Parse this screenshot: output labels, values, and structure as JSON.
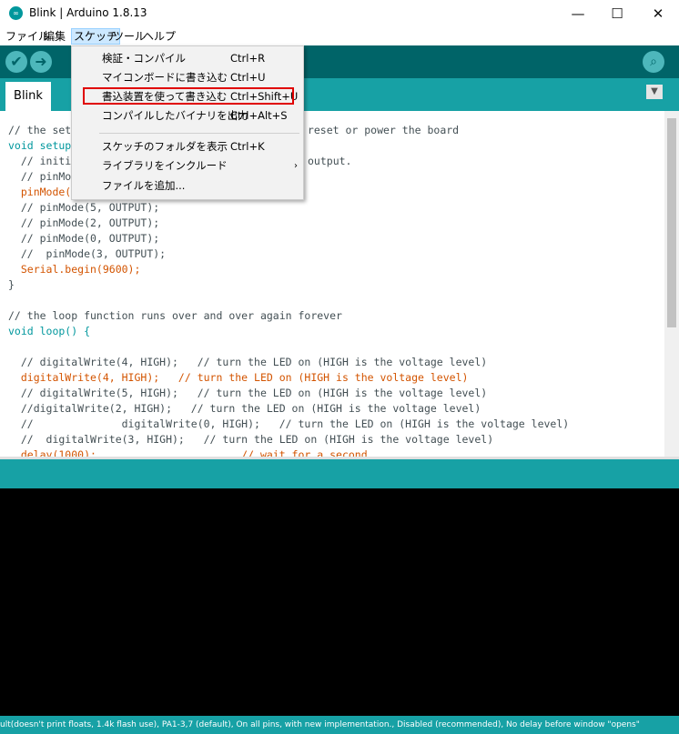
{
  "window": {
    "title": "Blink | Arduino 1.8.13",
    "minimize": "—",
    "maximize": "☐",
    "close": "✕"
  },
  "menubar": {
    "items": [
      "ファイル",
      "編集",
      "スケッチ",
      "ツール",
      "ヘルプ"
    ],
    "active_index": 2
  },
  "toolbar": {
    "verify_icon": "check-icon",
    "upload_icon": "arrow-right-icon",
    "serial_icon": "magnifier-icon"
  },
  "tabs": {
    "active": "Blink",
    "menu_icon": "▼"
  },
  "sketch_menu": {
    "items": [
      {
        "label": "検証・コンパイル",
        "shortcut": "Ctrl+R"
      },
      {
        "label": "マイコンボードに書き込む",
        "shortcut": "Ctrl+U"
      },
      {
        "label": "書込装置を使って書き込む",
        "shortcut": "Ctrl+Shift+U"
      },
      {
        "label": "コンパイルしたバイナリを出力",
        "shortcut": "Ctrl+Alt+S"
      },
      {
        "label": "スケッチのフォルダを表示",
        "shortcut": "Ctrl+K"
      },
      {
        "label": "ライブラリをインクルード",
        "shortcut": "",
        "submenu_arrow": "›"
      },
      {
        "label": "ファイルを追加...",
        "shortcut": ""
      }
    ]
  },
  "code": {
    "lines": [
      "// the set",
      " reset or power the board",
      "void setup",
      "  // initi",
      "output.",
      "  // pinMo",
      "  pinMode(",
      "  // pinMode(5, OUTPUT);",
      "  // pinMode(2, OUTPUT);",
      "  // pinMode(0, OUTPUT);",
      "  //  pinMode(3, OUTPUT);",
      "  Serial.begin(9600);",
      "}",
      "// the loop function runs over and over again forever",
      "void loop() {",
      "  // digitalWrite(4, HIGH);   // turn the LED on (HIGH is the voltage level)",
      "  digitalWrite(4, HIGH);   // turn the LED on (HIGH is the voltage level)",
      "  // digitalWrite(5, HIGH);   // turn the LED on (HIGH is the voltage level)",
      "  //digitalWrite(2, HIGH);   // turn the LED on (HIGH is the voltage level)",
      "  //              digitalWrite(0, HIGH);   // turn the LED on (HIGH is the voltage level)",
      "  //  digitalWrite(3, HIGH);   // turn the LED on (HIGH is the voltage level)",
      "  delay(1000);                       // wait for a second"
    ]
  },
  "status_bar": {
    "text": "ult(doesn't print floats, 1.4k flash use), PA1-3,7 (default), On all pins, with new implementation., Disabled (recommended), No delay before window \"opens\""
  },
  "colors": {
    "teal_dark": "#006468",
    "teal": "#17a1a5",
    "keyword": "#00979d",
    "function": "#d35400",
    "highlight_box": "#e00000"
  }
}
